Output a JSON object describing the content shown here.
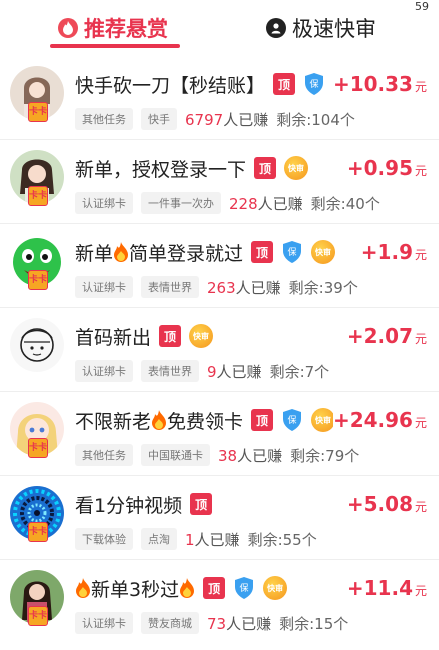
{
  "status": {
    "number": "59"
  },
  "tabs": [
    {
      "label": "推荐悬赏",
      "icon": "fire-icon",
      "active": true
    },
    {
      "label": "极速快审",
      "icon": "user-icon",
      "active": false
    }
  ],
  "colors": {
    "accent": "#e8344e",
    "tag_bg": "#f2f2f2",
    "badge_gold": "#f5a623"
  },
  "badges": {
    "ding": "顶",
    "bao": "保",
    "kuai": "快审",
    "avatar_tag": "卡卡"
  },
  "earned_suffix": "人已赚",
  "remain_prefix": "剩余:",
  "remain_suffix": "个",
  "currency_unit": "元",
  "items": [
    {
      "title": "快手砍一刀【秒结账】",
      "title_prefix_fire": false,
      "title_suffix_fire": false,
      "fire_mid": false,
      "tags": [
        "其他任务",
        "快手"
      ],
      "earned": "6797",
      "remain": "104",
      "price": "+10.33",
      "badges": [
        "ding",
        "bao",
        "kuai"
      ],
      "avatar": "girl-photo-avatar"
    },
    {
      "title": "新单，授权登录一下",
      "tags": [
        "认证绑卡",
        "一件事一次办"
      ],
      "earned": "228",
      "remain": "40",
      "price": "+0.95",
      "badges": [
        "ding",
        "kuai"
      ],
      "avatar": "girl-photo-avatar"
    },
    {
      "title_a": "新单",
      "title_b": "简单登录就过",
      "tags": [
        "认证绑卡",
        "表情世界"
      ],
      "earned": "263",
      "remain": "39",
      "price": "+1.9",
      "badges": [
        "ding",
        "bao",
        "kuai"
      ],
      "avatar": "green-frog-avatar"
    },
    {
      "title": "首码新出",
      "tags": [
        "认证绑卡",
        "表情世界"
      ],
      "earned": "9",
      "remain": "7",
      "price": "+2.07",
      "badges": [
        "ding",
        "kuai"
      ],
      "avatar": "sketch-face-avatar"
    },
    {
      "title_a": "不限新老",
      "title_b": "免费领卡",
      "tags": [
        "其他任务",
        "中国联通卡"
      ],
      "earned": "38",
      "remain": "79",
      "price": "+24.96",
      "badges": [
        "ding",
        "bao",
        "kuai"
      ],
      "avatar": "anime-girl-avatar"
    },
    {
      "title": "看1分钟视频",
      "tags": [
        "下载体验",
        "点淘"
      ],
      "earned": "1",
      "remain": "55",
      "price": "+5.08",
      "badges": [
        "ding"
      ],
      "avatar": "blue-swirl-avatar"
    },
    {
      "title_b": "新单3秒过",
      "tags": [
        "认证绑卡",
        "赞友商城"
      ],
      "earned": "73",
      "remain": "15",
      "price": "+11.4",
      "badges": [
        "ding",
        "bao",
        "kuai"
      ],
      "avatar": "girl-photo-avatar"
    }
  ]
}
